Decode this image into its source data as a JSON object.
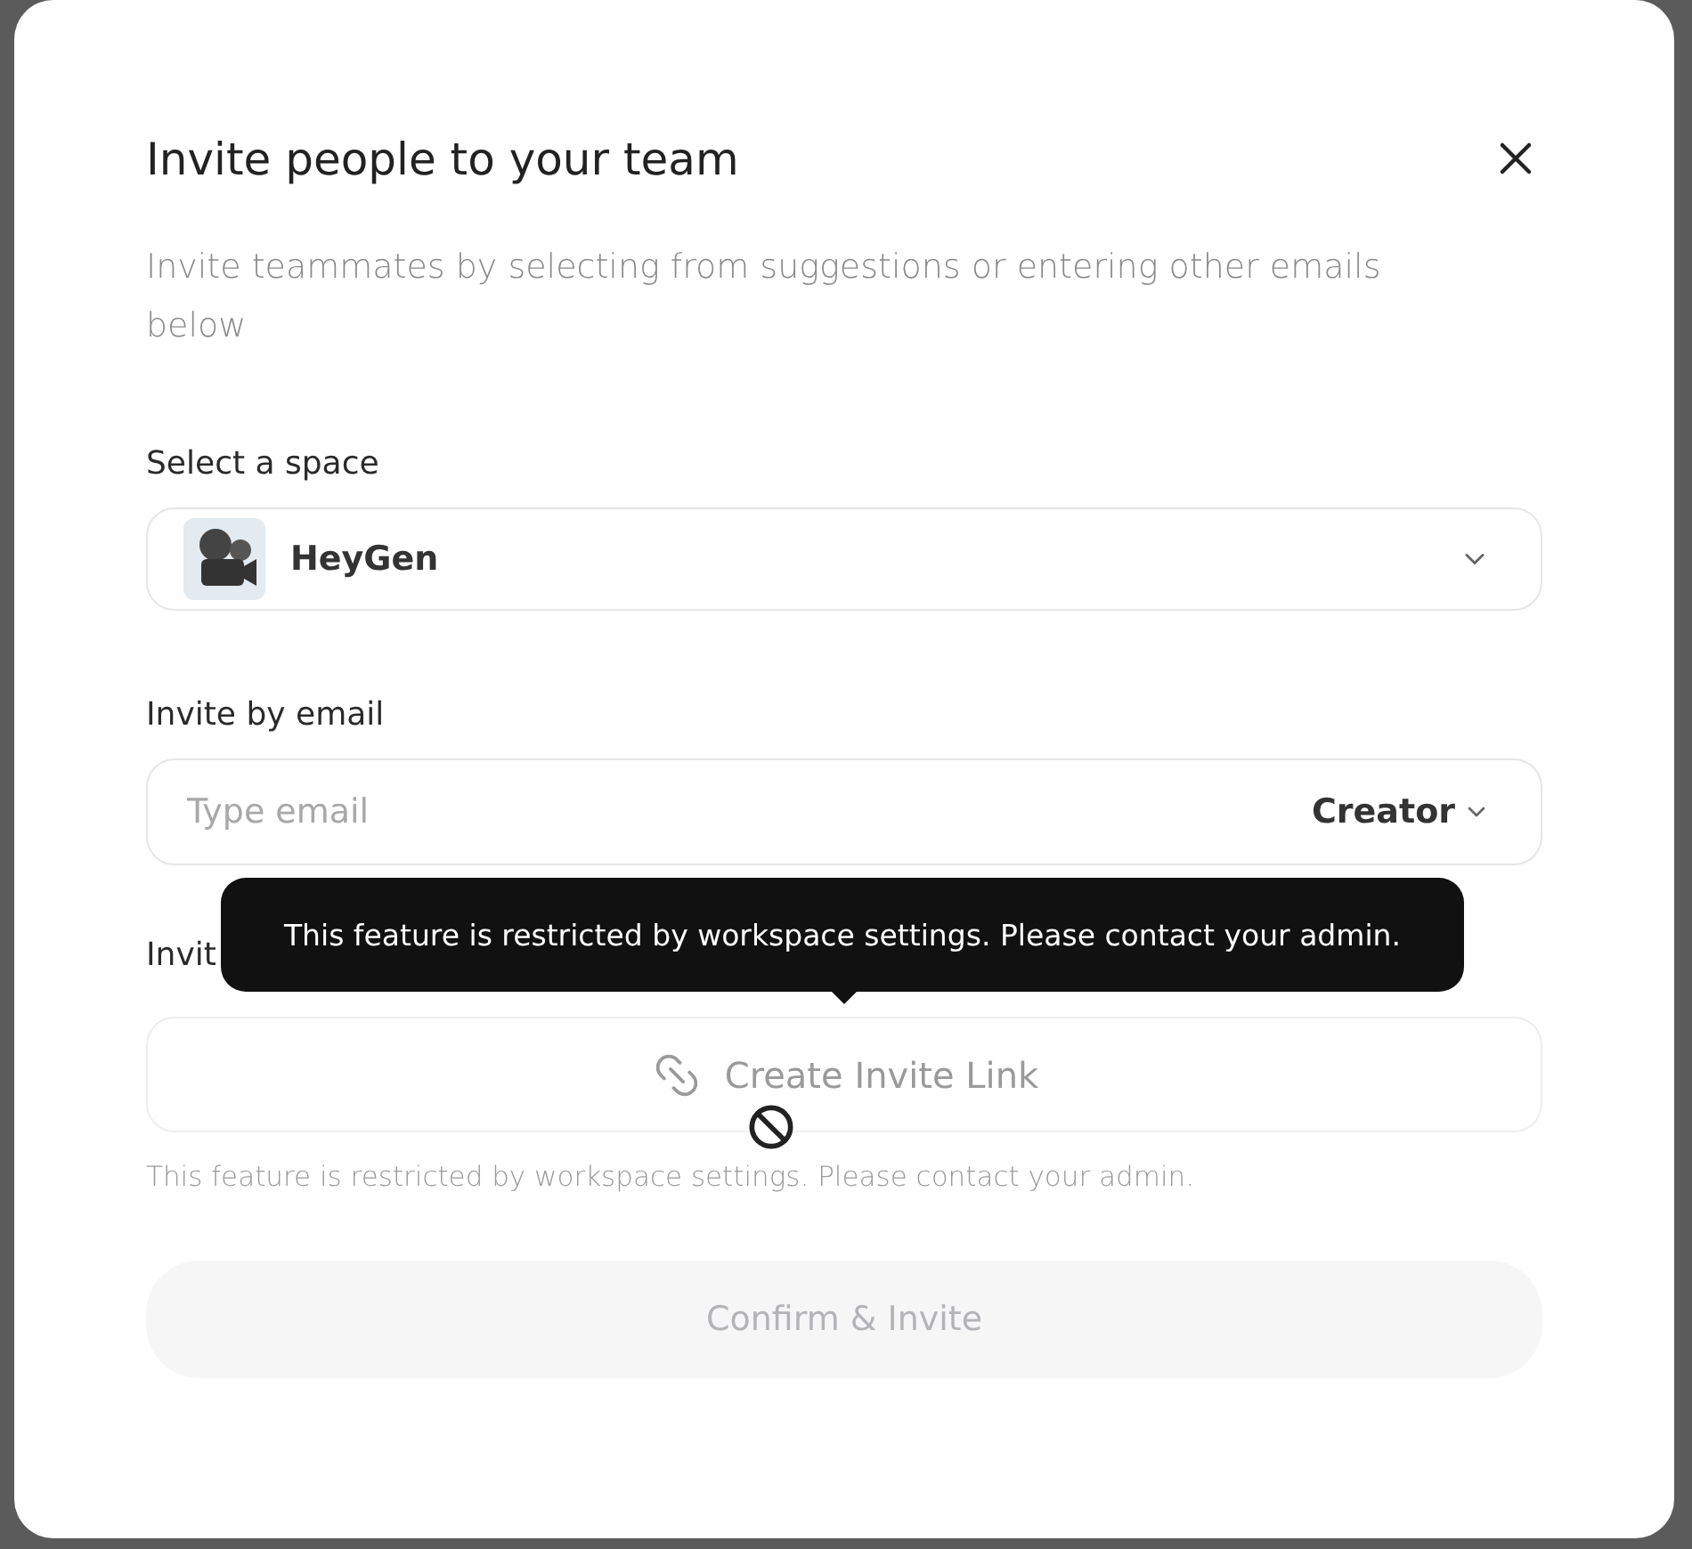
{
  "dialog": {
    "title": "Invite people to your team",
    "description": "Invite teammates by selecting from suggestions or entering other emails below"
  },
  "space": {
    "label": "Select a space",
    "value": "HeyGen"
  },
  "email": {
    "label": "Invite by email",
    "placeholder": "Type email",
    "role": "Creator"
  },
  "invite_link": {
    "label": "Invit",
    "button": "Create Invite Link",
    "disabled": true,
    "tooltip": "This feature is restricted by workspace settings. Please contact your admin.",
    "note": "This feature is restricted by workspace settings. Please contact your admin."
  },
  "confirm": {
    "label": "Confirm & Invite",
    "disabled": true
  }
}
